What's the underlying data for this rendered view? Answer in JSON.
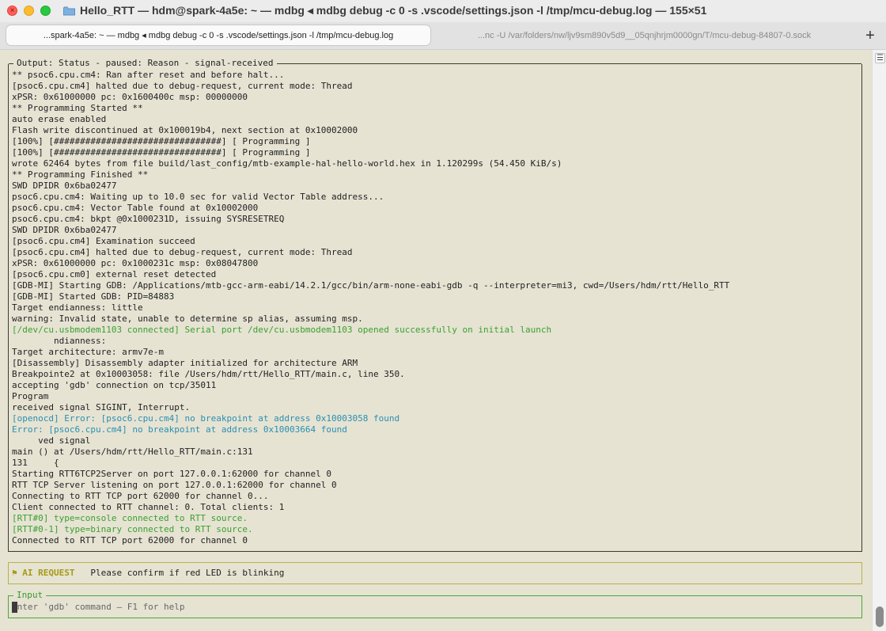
{
  "window": {
    "title": "Hello_RTT — hdm@spark-4a5e: ~ — mdbg ◂ mdbg debug -c 0 -s .vscode/settings.json -l /tmp/mcu-debug.log — 155×51",
    "folder_icon": "folder-icon"
  },
  "tabs": [
    {
      "label": "...spark-4a5e: ~ — mdbg ◂ mdbg debug -c 0 -s .vscode/settings.json -l /tmp/mcu-debug.log",
      "active": true
    },
    {
      "label": "...nc -U /var/folders/nw/ljv9sm890v5d9__05qnjhrjm0000gn/T/mcu-debug-84807-0.sock",
      "active": false
    }
  ],
  "new_tab_label": "+",
  "output": {
    "legend": "Output: Status - paused: Reason - signal-received",
    "lines": [
      {
        "text": "** psoc6.cpu.cm4: Ran after reset and before halt...",
        "color": "default"
      },
      {
        "text": "[psoc6.cpu.cm4] halted due to debug-request, current mode: Thread",
        "color": "default"
      },
      {
        "text": "xPSR: 0x61000000 pc: 0x1600400c msp: 00000000",
        "color": "default"
      },
      {
        "text": "** Programming Started **",
        "color": "default"
      },
      {
        "text": "auto erase enabled",
        "color": "default"
      },
      {
        "text": "Flash write discontinued at 0x100019b4, next section at 0x10002000",
        "color": "default"
      },
      {
        "text": "[100%] [################################] [ Programming ]",
        "color": "default"
      },
      {
        "text": "[100%] [################################] [ Programming ]",
        "color": "default"
      },
      {
        "text": "wrote 62464 bytes from file build/last_config/mtb-example-hal-hello-world.hex in 1.120299s (54.450 KiB/s)",
        "color": "default"
      },
      {
        "text": "** Programming Finished **",
        "color": "default"
      },
      {
        "text": "SWD DPIDR 0x6ba02477",
        "color": "default"
      },
      {
        "text": "psoc6.cpu.cm4: Waiting up to 10.0 sec for valid Vector Table address...",
        "color": "default"
      },
      {
        "text": "psoc6.cpu.cm4: Vector Table found at 0x10002000",
        "color": "default"
      },
      {
        "text": "psoc6.cpu.cm4: bkpt @0x1000231D, issuing SYSRESETREQ",
        "color": "default"
      },
      {
        "text": "SWD DPIDR 0x6ba02477",
        "color": "default"
      },
      {
        "text": "[psoc6.cpu.cm4] Examination succeed",
        "color": "default"
      },
      {
        "text": "[psoc6.cpu.cm4] halted due to debug-request, current mode: Thread",
        "color": "default"
      },
      {
        "text": "xPSR: 0x61000000 pc: 0x1000231c msp: 0x08047800",
        "color": "default"
      },
      {
        "text": "[psoc6.cpu.cm0] external reset detected",
        "color": "default"
      },
      {
        "text": "[GDB-MI] Starting GDB: /Applications/mtb-gcc-arm-eabi/14.2.1/gcc/bin/arm-none-eabi-gdb -q --interpreter=mi3, cwd=/Users/hdm/rtt/Hello_RTT",
        "color": "default"
      },
      {
        "text": "[GDB-MI] Started GDB: PID=84883",
        "color": "default"
      },
      {
        "text": "Target endianness: little",
        "color": "default"
      },
      {
        "text": "warning: Invalid state, unable to determine sp alias, assuming msp.",
        "color": "default"
      },
      {
        "text": "[/dev/cu.usbmodem1103 connected] Serial port /dev/cu.usbmodem1103 opened successfully on initial launch",
        "color": "green"
      },
      {
        "text": "        ndianness:",
        "color": "default"
      },
      {
        "text": "Target architecture: armv7e-m",
        "color": "default"
      },
      {
        "text": "[Disassembly] Disassembly adapter initialized for architecture ARM",
        "color": "default"
      },
      {
        "text": "Breakpointe2 at 0x10003058: file /Users/hdm/rtt/Hello_RTT/main.c, line 350.",
        "color": "default"
      },
      {
        "text": "accepting 'gdb' connection on tcp/35011",
        "color": "default"
      },
      {
        "text": "Program",
        "color": "default"
      },
      {
        "text": "received signal SIGINT, Interrupt.",
        "color": "default"
      },
      {
        "text": "[openocd] Error: [psoc6.cpu.cm4] no breakpoint at address 0x10003058 found",
        "color": "cyan"
      },
      {
        "text": "Error: [psoc6.cpu.cm4] no breakpoint at address 0x10003664 found",
        "color": "cyan"
      },
      {
        "text": "     ved signal",
        "color": "default"
      },
      {
        "text": "main () at /Users/hdm/rtt/Hello_RTT/main.c:131",
        "color": "default"
      },
      {
        "text": "131     {",
        "color": "default"
      },
      {
        "text": "Starting RTT6TCP2Server on port 127.0.0.1:62000 for channel 0",
        "color": "default"
      },
      {
        "text": "RTT TCP Server listening on port 127.0.0.1:62000 for channel 0",
        "color": "default"
      },
      {
        "text": "Connecting to RTT TCP port 62000 for channel 0...",
        "color": "default"
      },
      {
        "text": "Client connected to RTT channel: 0. Total clients: 1",
        "color": "default"
      },
      {
        "text": "[RTT#0] type=console connected to RTT source.",
        "color": "green"
      },
      {
        "text": "[RTT#0-1] type=binary connected to RTT source.",
        "color": "green"
      },
      {
        "text": "Connected to RTT TCP port 62000 for channel 0",
        "color": "default"
      }
    ]
  },
  "ai_request": {
    "flag": "⚑",
    "label": "AI REQUEST",
    "message": "Please confirm if red LED is blinking"
  },
  "input": {
    "legend": "Input",
    "value": "",
    "placeholder": "Enter 'gdb' command — F1 for help"
  },
  "scrollbar": {
    "menu_glyph": "☰"
  },
  "colors": {
    "background": "#e6e3d3",
    "green": "#3aa02f",
    "cyan": "#2a8fb0",
    "ai_accent": "#a69a16",
    "input_border": "#4aa83a"
  }
}
